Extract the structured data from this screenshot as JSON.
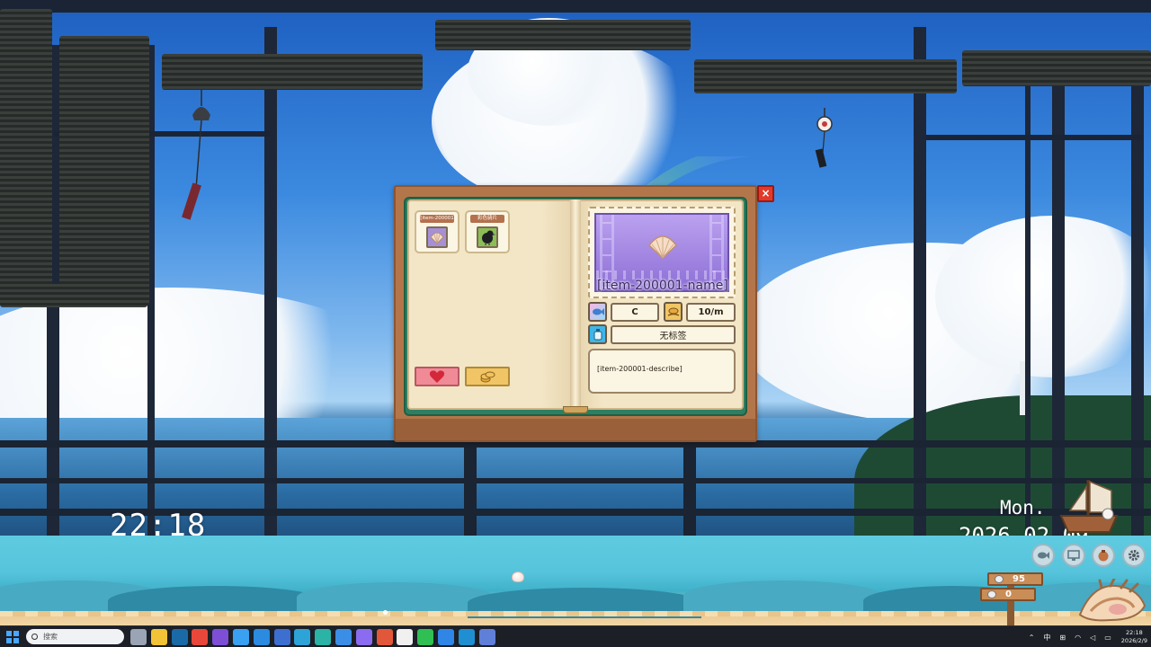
{
  "clock": {
    "time": "22:18",
    "weekday": "Mon.",
    "date": "2026-02-09"
  },
  "book": {
    "close_label": "×",
    "items": [
      {
        "tag": "[item-200001",
        "icon": "shell-icon"
      },
      {
        "tag": "彩色骑片",
        "icon": "crow-icon"
      }
    ],
    "detail": {
      "name": "[item-200001-name]",
      "rarity": "C",
      "rate": "10/m",
      "tag_label": "无标签",
      "description": "[item-200001-describe]"
    }
  },
  "counters": {
    "pearls": "95",
    "coins": "0"
  },
  "taskbar": {
    "search_placeholder": "搜索",
    "tray": {
      "ime": "中",
      "time": "22:18",
      "date": "2026/2/9"
    },
    "apps": [
      {
        "icon": "task-view-icon",
        "color": "#9aa4b5"
      },
      {
        "icon": "file-explorer-icon",
        "color": "#f2c336"
      },
      {
        "icon": "steam-icon",
        "color": "#1b6aa8"
      },
      {
        "icon": "chrome-icon",
        "color": "#e9473a"
      },
      {
        "icon": "obsidian-icon",
        "color": "#7c4fd6"
      },
      {
        "icon": "safari-icon",
        "color": "#3aa0f2"
      },
      {
        "icon": "vscode-icon",
        "color": "#2a8be0"
      },
      {
        "icon": "game-icon",
        "color": "#3d6fd1"
      },
      {
        "icon": "app-blue-icon",
        "color": "#2ea3d8"
      },
      {
        "icon": "edge-icon",
        "color": "#2bb3a6"
      },
      {
        "icon": "photos-icon",
        "color": "#3b8ee6"
      },
      {
        "icon": "app-purple-icon",
        "color": "#8b6cf0"
      },
      {
        "icon": "chrome-2-icon",
        "color": "#e2573a"
      },
      {
        "icon": "notion-icon",
        "color": "#f0f0f0"
      },
      {
        "icon": "wechat-icon",
        "color": "#2fbf52"
      },
      {
        "icon": "security-icon",
        "color": "#2f86e6"
      },
      {
        "icon": "app-teal-icon",
        "color": "#1f8fd1"
      },
      {
        "icon": "shell-game-icon",
        "color": "#5f7fd8"
      }
    ]
  },
  "colors": {
    "accent_red": "#e23a2a",
    "book_green": "#2f7e60",
    "preview_purple": "#8d6fd6"
  }
}
